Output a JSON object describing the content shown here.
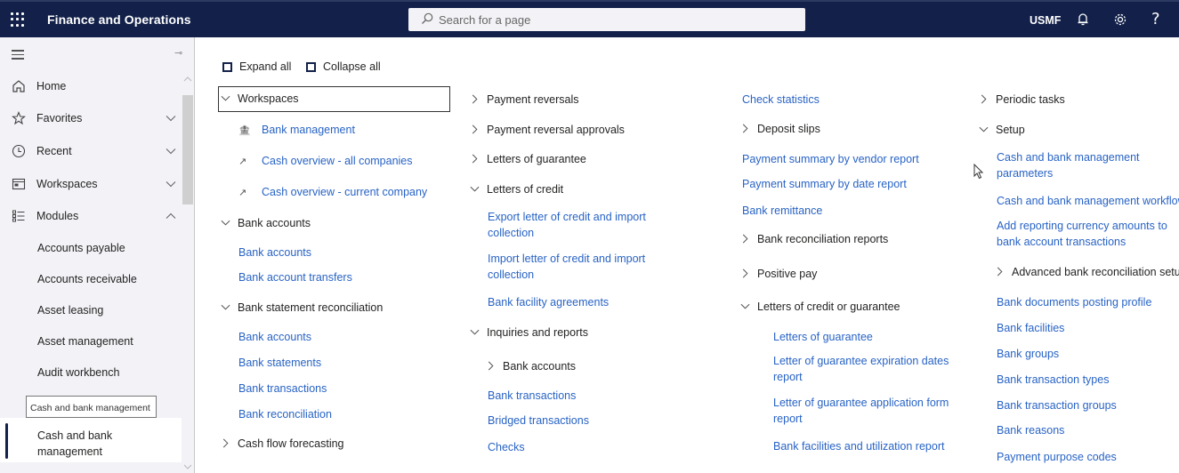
{
  "topbar": {
    "app_title": "Finance and Operations",
    "search_placeholder": "Search for a page",
    "company": "USMF",
    "icons": [
      "waffle-icon",
      "search-icon",
      "bell-icon",
      "gear-icon",
      "help-icon"
    ],
    "help_glyph": "?"
  },
  "nav": {
    "items": [
      {
        "label": "Home",
        "icon": "home-icon"
      },
      {
        "label": "Favorites",
        "icon": "star-icon",
        "expanded": false
      },
      {
        "label": "Recent",
        "icon": "clock-icon",
        "expanded": false
      },
      {
        "label": "Workspaces",
        "icon": "workspace-icon",
        "expanded": false
      },
      {
        "label": "Modules",
        "icon": "modules-icon",
        "expanded": true
      }
    ],
    "modules": [
      "Accounts payable",
      "Accounts receivable",
      "Asset leasing",
      "Asset management",
      "Audit workbench"
    ],
    "tooltip": "Cash and bank management",
    "selected": "Cash and bank management"
  },
  "toolbar": {
    "expand_all": "Expand all",
    "collapse_all": "Collapse all"
  },
  "columns": {
    "col1": [
      {
        "type": "header",
        "label": "Workspaces",
        "expanded": true
      },
      {
        "type": "workspace",
        "label": "Bank management",
        "icon": "bank-icon"
      },
      {
        "type": "workspace",
        "label": "Cash overview - all companies",
        "icon": "chart-trend-icon"
      },
      {
        "type": "workspace",
        "label": "Cash overview - current company",
        "icon": "chart-trend-icon"
      },
      {
        "type": "header",
        "label": "Bank accounts",
        "expanded": true
      },
      {
        "type": "link",
        "label": "Bank accounts"
      },
      {
        "type": "link",
        "label": "Bank account transfers"
      },
      {
        "type": "header",
        "label": "Bank statement reconciliation",
        "expanded": true
      },
      {
        "type": "link",
        "label": "Bank accounts"
      },
      {
        "type": "link",
        "label": "Bank statements"
      },
      {
        "type": "link",
        "label": "Bank transactions"
      },
      {
        "type": "link",
        "label": "Bank reconciliation"
      },
      {
        "type": "header",
        "label": "Cash flow forecasting",
        "expanded": false
      }
    ],
    "col2": [
      {
        "type": "header",
        "label": "Payment reversals",
        "expanded": false
      },
      {
        "type": "header",
        "label": "Payment reversal approvals",
        "expanded": false
      },
      {
        "type": "header",
        "label": "Letters of guarantee",
        "expanded": false
      },
      {
        "type": "header",
        "label": "Letters of credit",
        "expanded": true
      },
      {
        "type": "link",
        "label": "Export letter of credit and import collection"
      },
      {
        "type": "link",
        "label": "Import letter of credit and import collection"
      },
      {
        "type": "link",
        "label": "Bank facility agreements"
      },
      {
        "type": "header",
        "label": "Inquiries and reports",
        "expanded": true
      },
      {
        "type": "subheader",
        "label": "Bank accounts",
        "expanded": false
      },
      {
        "type": "link",
        "label": "Bank transactions"
      },
      {
        "type": "link",
        "label": "Bridged transactions"
      },
      {
        "type": "link",
        "label": "Checks"
      }
    ],
    "col3": [
      {
        "type": "link",
        "label": "Check statistics"
      },
      {
        "type": "subheader",
        "label": "Deposit slips",
        "expanded": false
      },
      {
        "type": "link",
        "label": "Payment summary by vendor report"
      },
      {
        "type": "link",
        "label": "Payment summary by date report"
      },
      {
        "type": "link",
        "label": "Bank remittance"
      },
      {
        "type": "subheader",
        "label": "Bank reconciliation reports",
        "expanded": false
      },
      {
        "type": "subheader",
        "label": "Positive pay",
        "expanded": false
      },
      {
        "type": "subheader",
        "label": "Letters of credit or guarantee",
        "expanded": true
      },
      {
        "type": "link",
        "label": "Letters of guarantee"
      },
      {
        "type": "link",
        "label": "Letter of guarantee expiration dates report"
      },
      {
        "type": "link",
        "label": "Letter of guarantee application form report"
      },
      {
        "type": "link",
        "label": "Bank facilities and utilization report"
      }
    ],
    "col4": [
      {
        "type": "header",
        "label": "Periodic tasks",
        "expanded": false
      },
      {
        "type": "header",
        "label": "Setup",
        "expanded": true
      },
      {
        "type": "link",
        "label": "Cash and bank management parameters"
      },
      {
        "type": "link",
        "label": "Cash and bank management workflows"
      },
      {
        "type": "link",
        "label": "Add reporting currency amounts to bank account transactions"
      },
      {
        "type": "subheader",
        "label": "Advanced bank reconciliation setup",
        "expanded": false
      },
      {
        "type": "link",
        "label": "Bank documents posting profile"
      },
      {
        "type": "link",
        "label": "Bank facilities"
      },
      {
        "type": "link",
        "label": "Bank groups"
      },
      {
        "type": "link",
        "label": "Bank transaction types"
      },
      {
        "type": "link",
        "label": "Bank transaction groups"
      },
      {
        "type": "link",
        "label": "Bank reasons"
      },
      {
        "type": "link",
        "label": "Payment purpose codes"
      }
    ]
  },
  "colors": {
    "topbar": "#13214a",
    "link": "#2863c5",
    "nav_bg": "#f3f2f7"
  }
}
